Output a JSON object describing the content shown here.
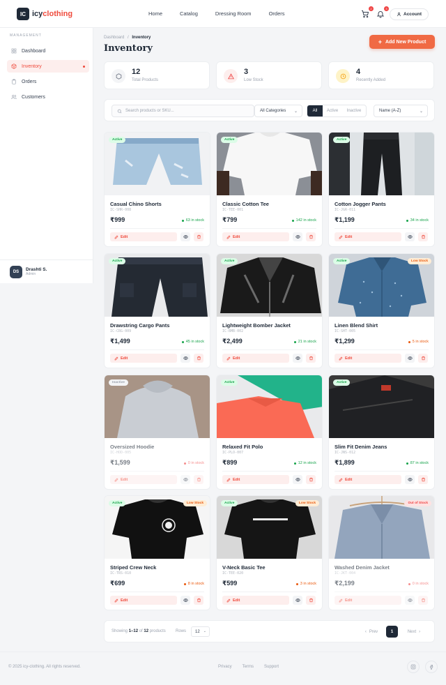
{
  "brand": {
    "badge": "IC",
    "name_a": "icy",
    "name_b": "clothing"
  },
  "nav": [
    "Home",
    "Catalog",
    "Dressing Room",
    "Orders"
  ],
  "header": {
    "cart_count": "2",
    "notif_count": "3",
    "account_label": "Account"
  },
  "sidebar": {
    "heading": "MANAGEMENT",
    "items": [
      {
        "label": "Dashboard",
        "icon": "grid-icon"
      },
      {
        "label": "Inventory",
        "icon": "box-icon"
      },
      {
        "label": "Orders",
        "icon": "clipboard-icon"
      },
      {
        "label": "Customers",
        "icon": "users-icon"
      }
    ],
    "user": {
      "initials": "DS",
      "name": "Drashti S.",
      "role": "Admin"
    }
  },
  "breadcrumb": {
    "parent": "Dashboard",
    "sep": "/",
    "current": "Inventory"
  },
  "page_title": "Inventory",
  "add_button": "Add New Product",
  "stats": [
    {
      "value": "12",
      "label": "Total Products",
      "color": "#6b7280"
    },
    {
      "value": "3",
      "label": "Low Stock",
      "color": "#ef4444"
    },
    {
      "value": "4",
      "label": "Recently Added",
      "color": "#f59e0b"
    }
  ],
  "filters": {
    "search_placeholder": "Search products or SKU...",
    "category": "All Categories",
    "status": [
      "All",
      "Active",
      "Inactive"
    ],
    "status_selected": "All",
    "sort": "Name (A-Z)"
  },
  "products": [
    {
      "name": "Casual Chino Shorts",
      "sku": "IC-SHR-008",
      "price": "₹999",
      "stock": "63 in stock",
      "stock_tone": "g",
      "badge": "Active",
      "badge2": "",
      "img": "shorts",
      "dim": false
    },
    {
      "name": "Classic Cotton Tee",
      "sku": "IC-TEE-001",
      "price": "₹799",
      "stock": "142 in stock",
      "stock_tone": "g",
      "badge": "Active",
      "badge2": "",
      "img": "whitetee",
      "dim": false
    },
    {
      "name": "Cotton Jogger Pants",
      "sku": "IC-JGR-011",
      "price": "₹1,199",
      "stock": "34 in stock",
      "stock_tone": "g",
      "badge": "Active",
      "badge2": "",
      "img": "joggers",
      "dim": false
    },
    {
      "name": "Drawstring Cargo Pants",
      "sku": "IC-CRG-009",
      "price": "₹1,499",
      "stock": "45 in stock",
      "stock_tone": "g",
      "badge": "Active",
      "badge2": "",
      "img": "cargo",
      "dim": false
    },
    {
      "name": "Lightweight Bomber Jacket",
      "sku": "IC-BMB-002",
      "price": "₹2,499",
      "stock": "21 in stock",
      "stock_tone": "g",
      "badge": "Active",
      "badge2": "",
      "img": "bomber",
      "dim": false
    },
    {
      "name": "Linen Blend Shirt",
      "sku": "IC-SHT-005",
      "price": "₹1,299",
      "stock": "5 in stock",
      "stock_tone": "o",
      "badge": "Active",
      "badge2": "Low Stock",
      "b2": "low",
      "img": "shirt",
      "dim": false
    },
    {
      "name": "Oversized Hoodie",
      "sku": "IC-HOD-005",
      "price": "₹1,599",
      "stock": "0 in stock",
      "stock_tone": "r",
      "badge": "Inactive",
      "badge2": "",
      "img": "hoodie",
      "dim": true
    },
    {
      "name": "Relaxed Fit Polo",
      "sku": "IC-PLO-007",
      "price": "₹899",
      "stock": "12 in stock",
      "stock_tone": "g",
      "badge": "Active",
      "badge2": "",
      "img": "polo",
      "dim": false
    },
    {
      "name": "Slim Fit Denim Jeans",
      "sku": "IC-JNS-012",
      "price": "₹1,899",
      "stock": "87 in stock",
      "stock_tone": "g",
      "badge": "Active",
      "badge2": "",
      "img": "jeans",
      "dim": false
    },
    {
      "name": "Striped Crew Neck",
      "sku": "IC-TRS-010",
      "price": "₹699",
      "stock": "8 in stock",
      "stock_tone": "o",
      "badge": "Active",
      "badge2": "Low Stock",
      "b2": "low",
      "img": "blacktee1",
      "dim": false
    },
    {
      "name": "V-Neck Basic Tee",
      "sku": "IC-TEE-020",
      "price": "₹599",
      "stock": "3 in stock",
      "stock_tone": "o",
      "badge": "Active",
      "badge2": "Low Stock",
      "b2": "low",
      "img": "blacktee2",
      "dim": false
    },
    {
      "name": "Washed Denim Jacket",
      "sku": "IC-JKT-004",
      "price": "₹2,199",
      "stock": "0 in stock",
      "stock_tone": "r",
      "badge": "",
      "badge2": "Out of Stock",
      "b2": "out",
      "img": "denimjkt",
      "dim": true
    }
  ],
  "card_labels": {
    "edit": "Edit"
  },
  "pagination": {
    "showing_pre": "Showing",
    "range": "1–12",
    "of": "of",
    "total": "12",
    "products": "products",
    "rows_label": "Rows",
    "rows_value": "12",
    "prev": "Prev",
    "page": "1",
    "next": "Next"
  },
  "footer": {
    "copyright": "© 2025 icy-clothing. All rights reserved.",
    "links": [
      "Privacy",
      "Terms",
      "Support"
    ]
  }
}
